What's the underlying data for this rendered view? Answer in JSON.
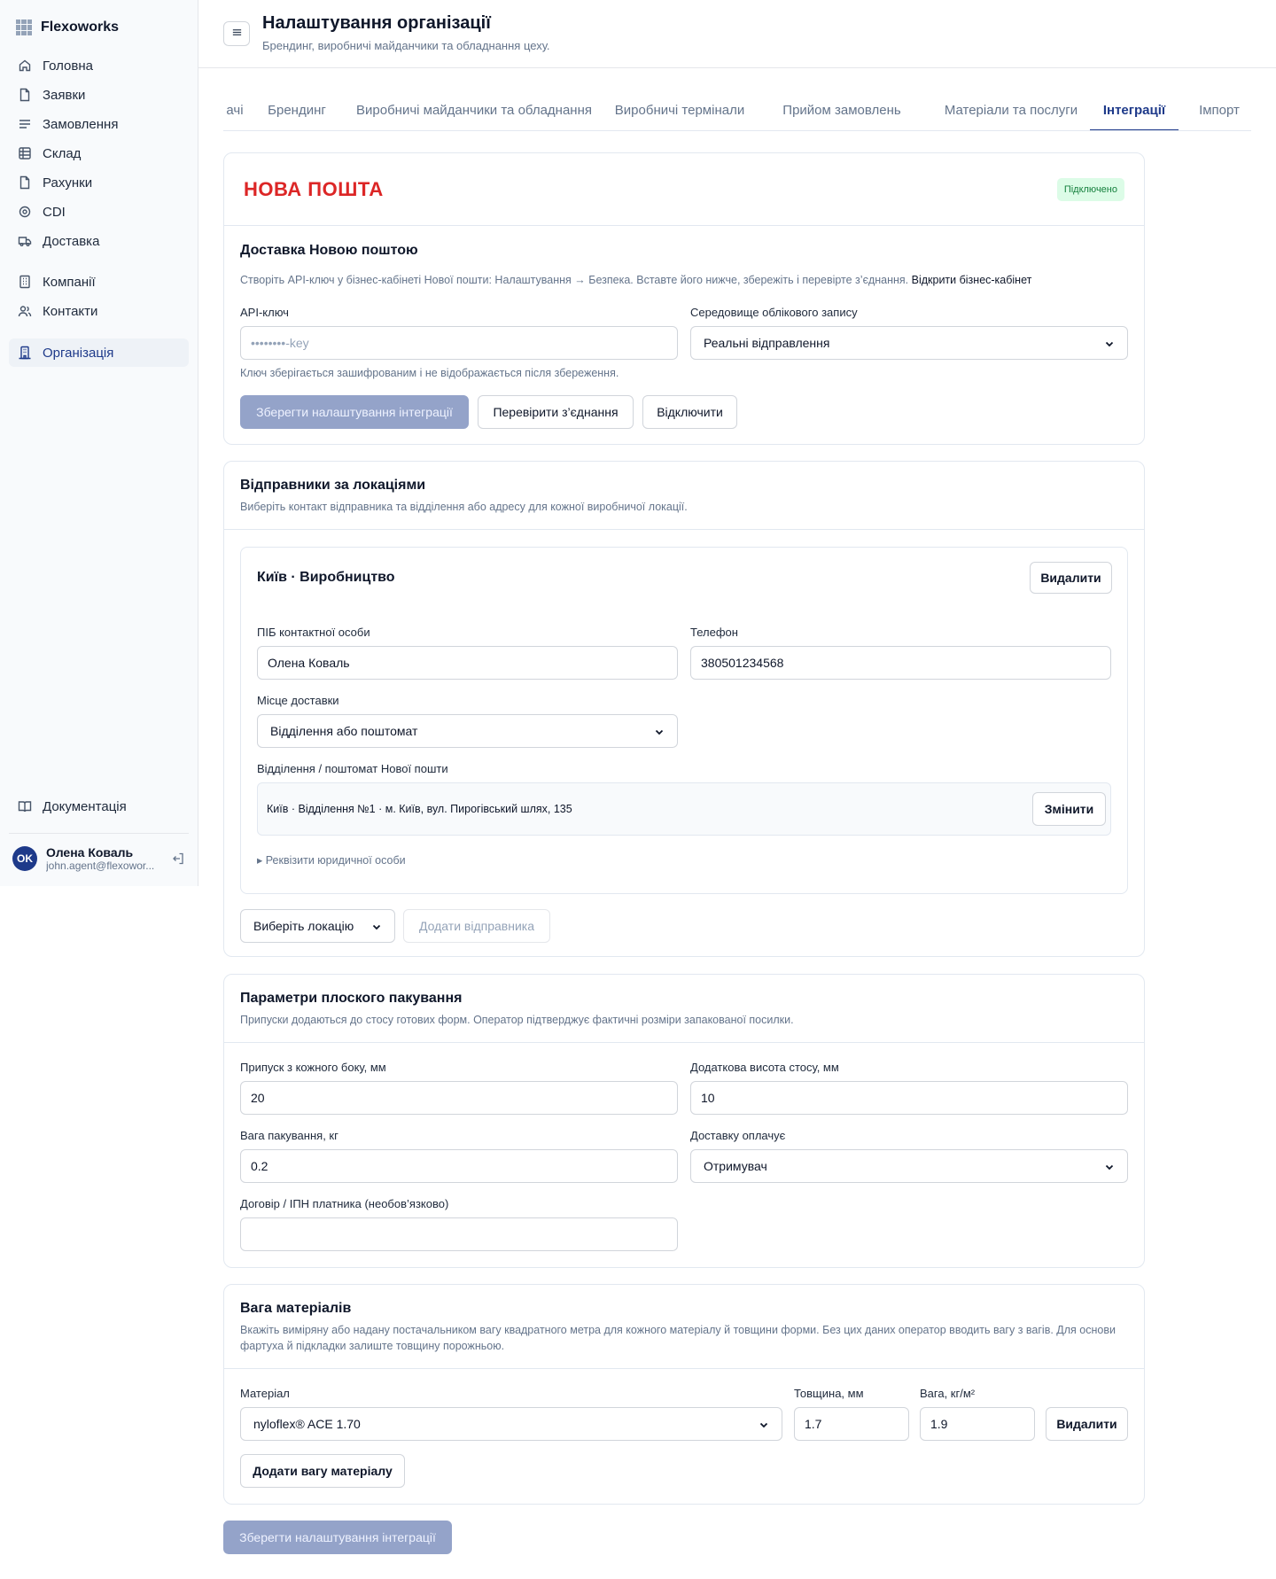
{
  "app": {
    "name": "Flexoworks"
  },
  "sidebar": {
    "items": [
      {
        "label": "Головна",
        "icon": "home-icon"
      },
      {
        "label": "Заявки",
        "icon": "file-icon"
      },
      {
        "label": "Замовлення",
        "icon": "list-icon"
      },
      {
        "label": "Склад",
        "icon": "warehouse-icon"
      },
      {
        "label": "Рахунки",
        "icon": "file-icon"
      },
      {
        "label": "CDI",
        "icon": "target-icon"
      },
      {
        "label": "Доставка",
        "icon": "truck-icon"
      },
      {
        "label": "Компанії",
        "icon": "building-icon"
      },
      {
        "label": "Контакти",
        "icon": "users-icon"
      },
      {
        "label": "Організація",
        "icon": "organization-icon"
      }
    ],
    "docs_label": "Документація",
    "user": {
      "initials": "OK",
      "name": "Олена Коваль",
      "email": "john.agent@flexowor..."
    }
  },
  "header": {
    "title": "Налаштування організації",
    "subtitle": "Брендинг, виробничі майданчики та обладнання цеху."
  },
  "tabs": [
    "ачі",
    "Брендинг",
    "Виробничі майданчики та обладнання",
    "Виробничі термінали",
    "Прийом замовлень",
    "Матеріали та послуги",
    "Інтеграції",
    "Імпорт"
  ],
  "active_tab": "Інтеграції",
  "nova_poshta": {
    "logo_text": "НОВА ПОШТА",
    "status": "Підключено",
    "title": "Доставка Новою поштою",
    "desc": "Створіть API-ключ у бізнес-кабінеті Нової пошти: Налаштування → Безпека. Вставте його нижче, збережіть і перевірте з’єднання.",
    "link": "Відкрити бізнес-кабінет",
    "api_key_label": "API-ключ",
    "api_key_placeholder": "••••••••-key",
    "env_label": "Середовище облікового запису",
    "env_value": "Реальні відправлення",
    "key_hint": "Ключ зберігається зашифрованим і не відображається після збереження.",
    "save_button": "Зберегти налаштування інтеграції",
    "check_button": "Перевірити з’єднання",
    "disconnect_button": "Відключити"
  },
  "senders": {
    "title": "Відправники за локаціями",
    "desc": "Виберіть контакт відправника та відділення або адресу для кожної виробничої локації.",
    "location": {
      "name": "Київ · Виробництво",
      "delete_button": "Видалити",
      "contact_label": "ПІБ контактної особи",
      "contact_value": "Олена Коваль",
      "phone_label": "Телефон",
      "phone_value": "380501234568",
      "place_label": "Місце доставки",
      "place_value": "Відділення або поштомат",
      "branch_label": "Відділення / поштомат Нової пошти",
      "branch_value": "Київ · Відділення №1 · м. Київ, вул. Пирогівський шлях, 135",
      "change_button": "Змінити",
      "legal_toggle": "▸ Реквізити юридичної особи"
    },
    "select_location": "Виберіть локацію",
    "add_sender_button": "Додати відправника"
  },
  "packaging": {
    "title": "Параметри плоского пакування",
    "desc": "Припуски додаються до стосу готових форм. Оператор підтверджує фактичні розміри запакованої посилки.",
    "margin_label": "Припуск з кожного боку, мм",
    "margin_value": "20",
    "height_label": "Додаткова висота стосу, мм",
    "height_value": "10",
    "weight_label": "Вага пакування, кг",
    "weight_value": "0.2",
    "payer_label": "Доставку оплачує",
    "payer_value": "Отримувач",
    "contract_label": "Договір / ІПН платника (необов’язково)",
    "contract_value": ""
  },
  "materials": {
    "title": "Вага матеріалів",
    "desc": "Вкажіть виміряну або надану постачальником вагу квадратного метра для кожного матеріалу й товщини форми. Без цих даних оператор вводить вагу з вагів. Для основи фартуха й підкладки залиште товщину порожньою.",
    "material_label": "Матеріал",
    "material_value": "nyloflex® ACE 1.70",
    "thickness_label": "Товщина, мм",
    "thickness_value": "1.7",
    "weight_label": "Вага, кг/м²",
    "weight_value": "1.9",
    "delete_button": "Видалити",
    "add_button": "Додати вагу матеріалу"
  },
  "footer_save_button": "Зберегти налаштування інтеграції"
}
